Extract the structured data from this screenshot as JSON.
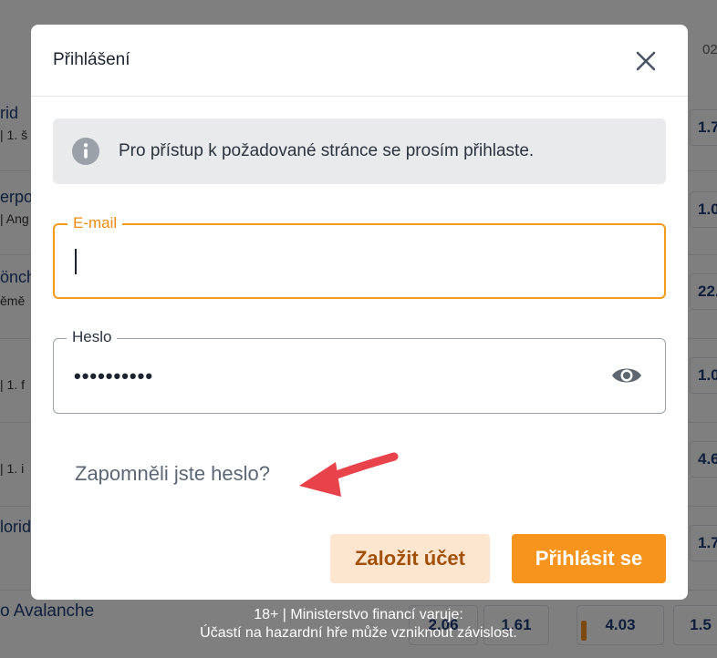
{
  "background": {
    "header_fragment": "02",
    "rows": [
      {
        "name": "rid",
        "sub": "| 1. š",
        "odd": "1.7"
      },
      {
        "name": "erpo",
        "sub": "| Ang",
        "odd": "1.0"
      },
      {
        "name": "önch",
        "sub": "ěmě",
        "odd": "22."
      },
      {
        "name": "",
        "sub": "| 1. f",
        "odd": "1.0"
      },
      {
        "name": "",
        "sub": "| 1. i",
        "odd": "4.6"
      },
      {
        "name": "lorid",
        "sub": "",
        "odd": "1.7"
      }
    ],
    "bottom_row": {
      "name": "o Avalanche",
      "odds": [
        "2.06",
        "1.61",
        "4.03",
        "1.5"
      ]
    }
  },
  "footer_warning": {
    "line1": "18+ | Ministerstvo financí varuje:",
    "line2": "Účastí na hazardní hře může vzniknout závislost."
  },
  "modal": {
    "title": "Přihlášení",
    "close_icon": "close-icon",
    "info": {
      "icon": "info-icon",
      "text": "Pro přístup k požadované stránce se prosím přihlaste."
    },
    "email": {
      "label": "E-mail",
      "value": "",
      "focused": true
    },
    "password": {
      "label": "Heslo",
      "value": "••••••••••",
      "toggle_icon": "eye-icon"
    },
    "forgot_password": "Zapomněli jste heslo?",
    "annotation_icon": "red-arrow-icon",
    "register_button": "Založit účet",
    "login_button": "Přihlásit se"
  },
  "colors": {
    "accent": "#f7941d",
    "accent_light": "#fde6d0",
    "arrow": "#e8424a",
    "overlay": "rgba(0,0,0,0.5)"
  }
}
